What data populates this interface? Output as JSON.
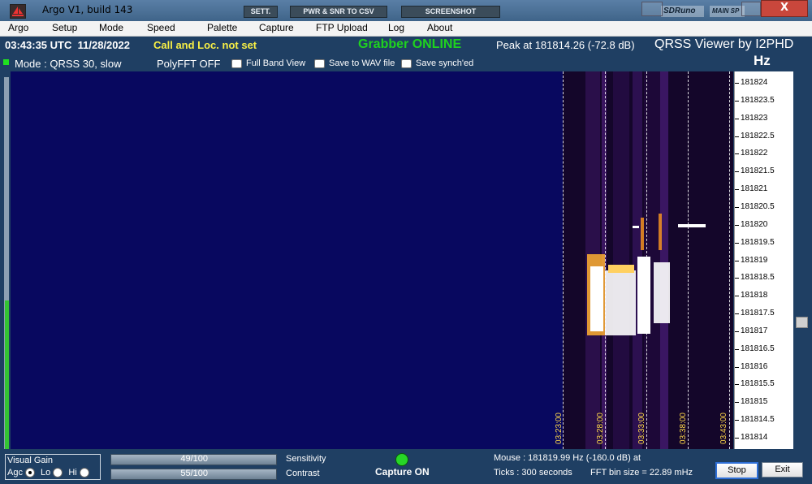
{
  "window": {
    "title": "Argo V1, build 143"
  },
  "toolbar": {
    "sett": "SETT.",
    "pwr_snr": "PWR & SNR TO CSV",
    "screenshot": "SCREENSHOT",
    "ghost_sdruno": "SDRuno",
    "ghost_mainsp": "MAIN SP",
    "close": "X"
  },
  "menu": [
    "Argo",
    "Setup",
    "Mode",
    "Speed",
    "Palette",
    "Capture",
    "FTP Upload",
    "Log",
    "About"
  ],
  "info": {
    "utc": "03:43:35 UTC",
    "date": "11/28/2022",
    "callloc": "Call and Loc. not set",
    "grabber": "Grabber ONLINE",
    "peak": "Peak at  181814.26 (-72.8 dB)",
    "viewer": "QRSS Viewer by I2PHD",
    "hz_unit": "Hz",
    "mode": "Mode : QRSS 30, slow",
    "polyfft": "PolyFFT OFF",
    "full_band": "Full Band View",
    "save_wav": "Save to WAV file",
    "save_synch": "Save synch'ed"
  },
  "waterfall": {
    "time_ticks": [
      "03:23:00",
      "03:28:00",
      "03:33:00",
      "03:38:00",
      "03:43:00"
    ],
    "freq_labels": [
      "181824",
      "181823.5",
      "181823",
      "181822.5",
      "181822",
      "181821.5",
      "181821",
      "181820.5",
      "181820",
      "181819.5",
      "181819",
      "181818.5",
      "181818",
      "181817.5",
      "181817",
      "181816.5",
      "181816",
      "181815.5",
      "181815",
      "181814.5",
      "181814"
    ]
  },
  "bottom": {
    "visual_gain": "Visual Gain",
    "agc": "Agc",
    "lo": "Lo",
    "hi": "Hi",
    "sensitivity_value": "49/100",
    "sensitivity_label": "Sensitivity",
    "sensitivity_level": 0.49,
    "contrast_value": "55/100",
    "contrast_label": "Contrast",
    "contrast_level": 0.55,
    "capture": "Capture ON",
    "mouse": "Mouse :   181819.99 Hz  (-160.0 dB) at",
    "ticks": "Ticks  : 300 seconds",
    "fftbin": "FFT bin size = 22.89 mHz",
    "stop": "Stop",
    "exit": "Exit"
  },
  "colors": {
    "waterfall_bg": "#08085f",
    "grabber": "#1fd21f",
    "callloc": "#f7ef45",
    "tick_label": "#ffd84a"
  }
}
